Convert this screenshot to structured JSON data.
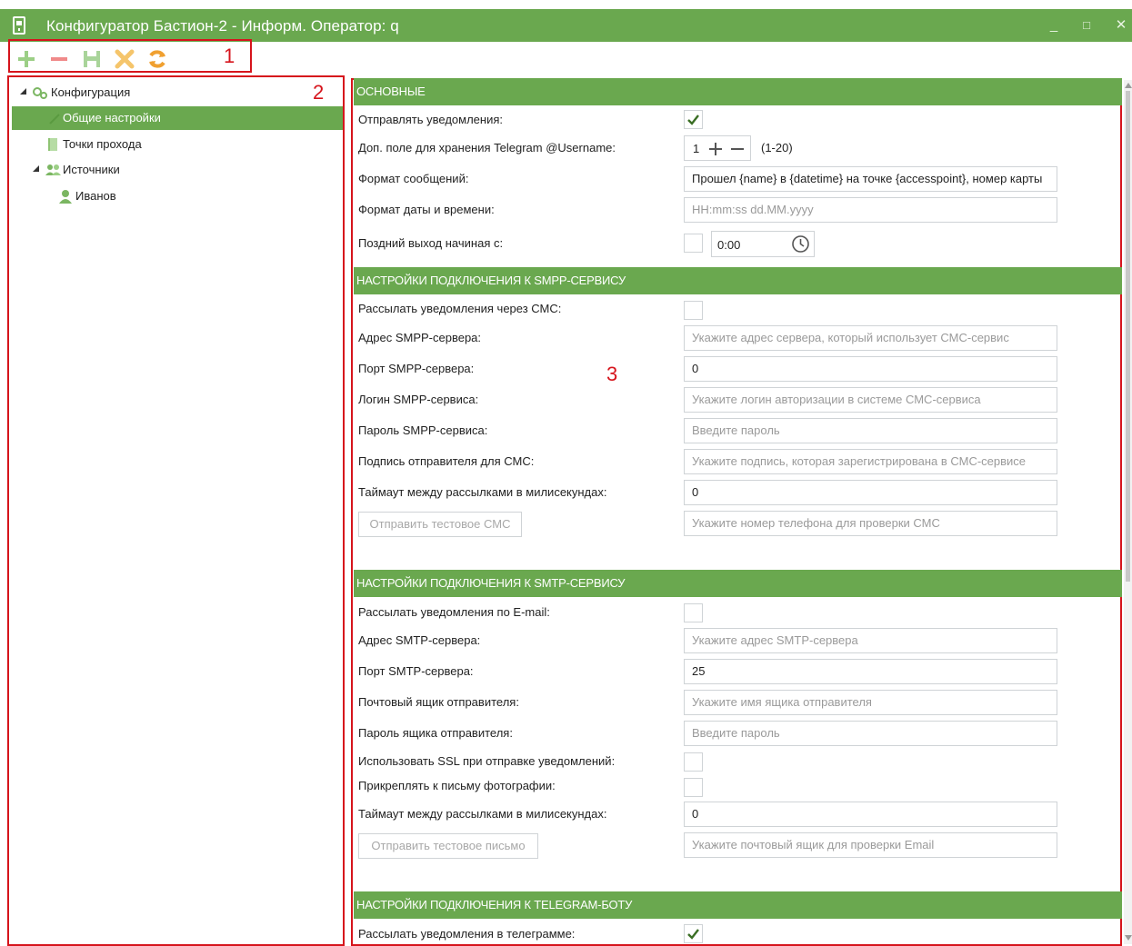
{
  "window": {
    "title": "Конфигуратор Бастион-2 - Информ. Оператор: q",
    "minimize": "_",
    "maximize": "□",
    "close": "✕",
    "accent": "#6aa84f"
  },
  "toolbar": {
    "icons": [
      "plus-icon",
      "minus-icon",
      "save-icon",
      "delete-icon",
      "refresh-icon"
    ]
  },
  "annotations": {
    "toolbar": "1",
    "tree": "2",
    "settings": "3",
    "color": "#d6141c"
  },
  "tree": {
    "root": "Конфигурация",
    "general": "Общие настройки",
    "points": "Точки прохода",
    "sources": "Источники",
    "user": "Иванов"
  },
  "basic": {
    "header": "ОСНОВНЫЕ",
    "send_label": "Отправлять уведомления:",
    "send_checked": true,
    "extra_label": "Доп. поле для хранения Telegram @Username:",
    "extra_value": "1",
    "extra_range": "(1-20)",
    "format_label": "Формат сообщений:",
    "format_value": "Прошел {name} в {datetime} на точке {accesspoint}, номер карты",
    "datetime_label": "Формат даты и времени:",
    "datetime_placeholder": "HH:mm:ss dd.MM.yyyy",
    "late_label": "Поздний выход начиная с:",
    "late_time": "0:00"
  },
  "smpp": {
    "header": "НАСТРОЙКИ ПОДКЛЮЧЕНИЯ К SMPP-СЕРВИСУ",
    "send_label": "Рассылать уведомления через СМС:",
    "address_label": "Адрес SMPP-сервера:",
    "address_placeholder": "Укажите адрес сервера, который использует СМС-сервис",
    "port_label": "Порт SMPP-сервера:",
    "port_value": "0",
    "login_label": "Логин SMPP-сервиса:",
    "login_placeholder": "Укажите логин авторизации в системе СМС-сервиса",
    "password_label": "Пароль SMPP-сервиса:",
    "password_placeholder": "Введите пароль",
    "signature_label": "Подпись отправителя для СМС:",
    "signature_placeholder": "Укажите подпись, которая зарегистрирована в СМС-сервисе",
    "timeout_label": "Таймаут между рассылками в милисекундах:",
    "timeout_value": "0",
    "test_button": "Отправить тестовое СМС",
    "test_placeholder": "Укажите номер телефона для проверки СМС"
  },
  "smtp": {
    "header": "НАСТРОЙКИ ПОДКЛЮЧЕНИЯ К SMTP-СЕРВИСУ",
    "send_label": "Рассылать уведомления по E-mail:",
    "address_label": "Адрес SMTP-сервера:",
    "address_placeholder": "Укажите адрес SMTP-сервера",
    "port_label": "Порт SMTP-сервера:",
    "port_value": "25",
    "mailbox_label": "Почтовый ящик отправителя:",
    "mailbox_placeholder": "Укажите имя ящика отправителя",
    "password_label": "Пароль ящика отправителя:",
    "password_placeholder": "Введите пароль",
    "ssl_label": "Использовать SSL при отправке уведомлений:",
    "attach_label": "Прикреплять к письму фотографии:",
    "timeout_label": "Таймаут между рассылками в милисекундах:",
    "timeout_value": "0",
    "test_button": "Отправить тестовое письмо",
    "test_placeholder": "Укажите почтовый ящик для проверки Email"
  },
  "telegram": {
    "header": "НАСТРОЙКИ ПОДКЛЮЧЕНИЯ К TELEGRAM-БОТУ",
    "send_label": "Рассылать уведомления в телеграмме:",
    "send_checked": true
  }
}
